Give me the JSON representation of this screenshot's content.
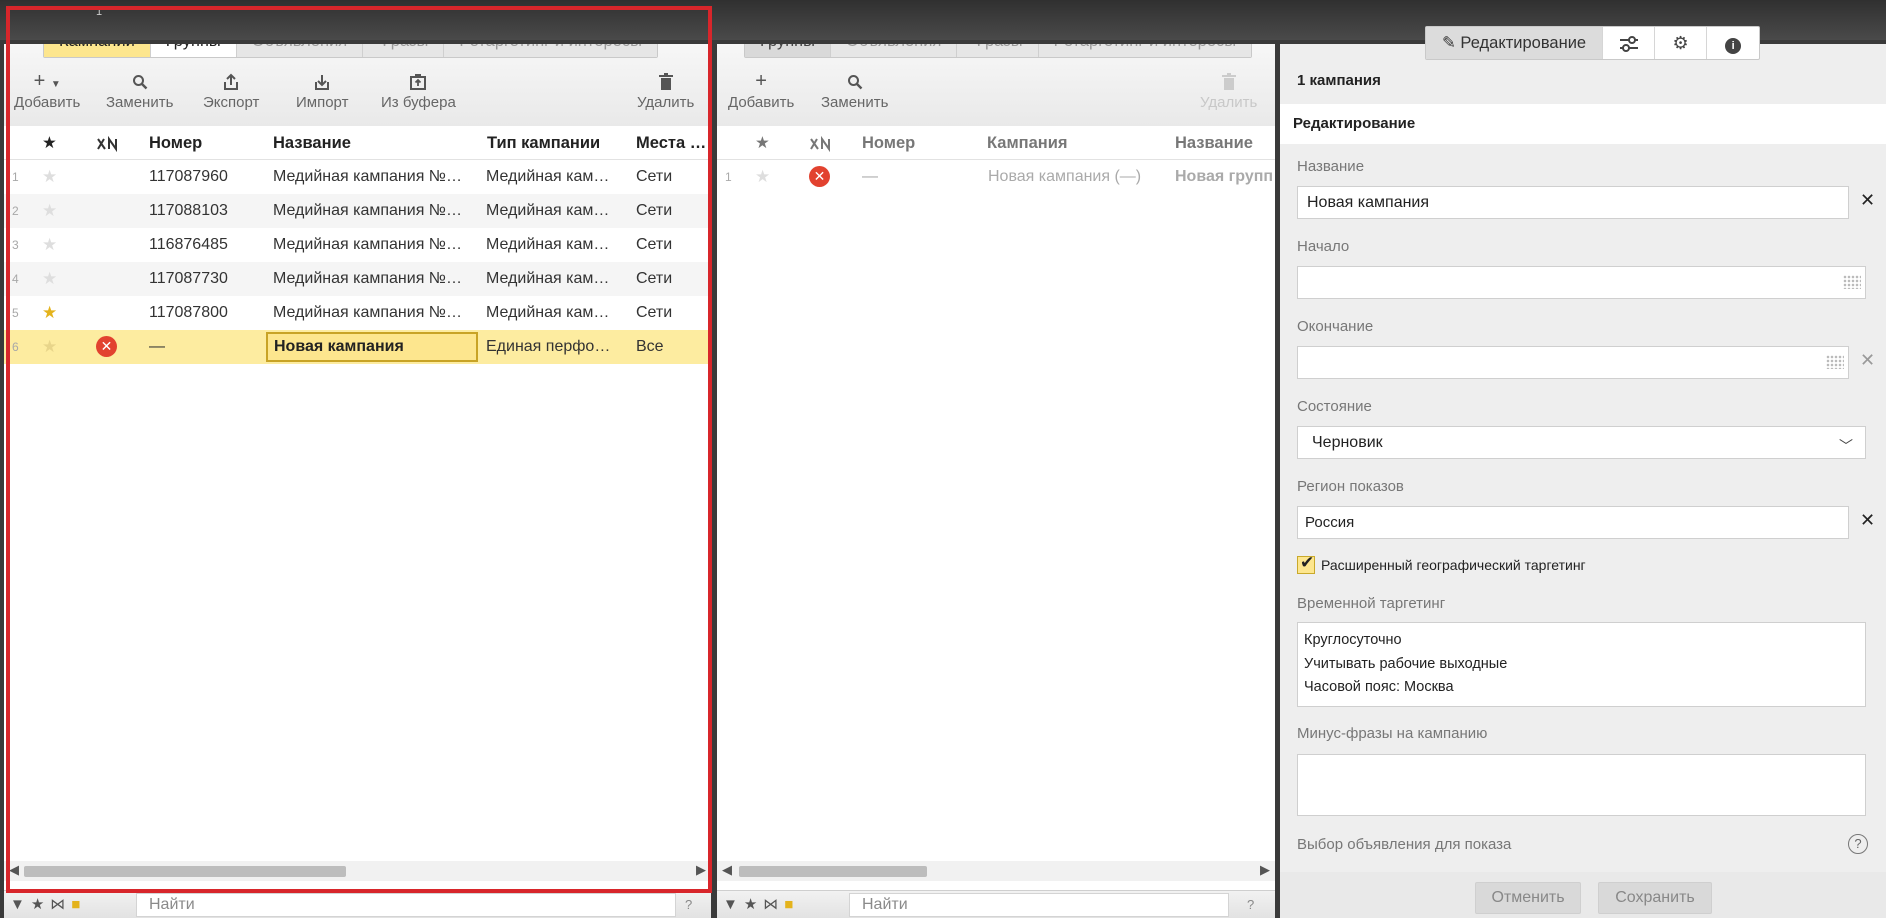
{
  "left": {
    "tab_number": "1",
    "tabs": [
      "Кампании",
      "Группы",
      "Объявления",
      "Фразы",
      "Ретаргетинг и интересы"
    ],
    "toolbar": {
      "add": "Добавить",
      "replace": "Заменить",
      "export": "Экспорт",
      "import": "Импорт",
      "clipboard": "Из буфера",
      "delete": "Удалить"
    },
    "columns": {
      "star": "★",
      "number": "Номер",
      "name": "Название",
      "type": "Тип кампании",
      "places": "Места …"
    },
    "rows": [
      {
        "idx": "1",
        "number": "117087960",
        "name": "Медийная кампания №…",
        "type": "Медийная кам…",
        "places": "Сети"
      },
      {
        "idx": "2",
        "number": "117088103",
        "name": "Медийная кампания №…",
        "type": "Медийная кам…",
        "places": "Сети"
      },
      {
        "idx": "3",
        "number": "116876485",
        "name": "Медийная кампания №…",
        "type": "Медийная кам…",
        "places": "Сети"
      },
      {
        "idx": "4",
        "number": "117087730",
        "name": "Медийная кампания №…",
        "type": "Медийная кам…",
        "places": "Сети"
      },
      {
        "idx": "5",
        "number": "117087800",
        "name": "Медийная кампания №…",
        "type": "Медийная кам…",
        "places": "Сети"
      },
      {
        "idx": "6",
        "number": "—",
        "name": "Новая кампания",
        "type": "Единая перфо…",
        "places": "Все"
      }
    ],
    "search_placeholder": "Найти",
    "help": "?"
  },
  "mid": {
    "tabs": [
      "Группы",
      "Объявления",
      "Фразы",
      "Ретаргетинг и интересы"
    ],
    "toolbar": {
      "add": "Добавить",
      "replace": "Заменить",
      "delete": "Удалить"
    },
    "columns": {
      "star": "★",
      "number": "Номер",
      "campaign": "Кампания",
      "name": "Название"
    },
    "rows": [
      {
        "idx": "1",
        "number": "—",
        "campaign": "Новая кампания (—)",
        "name": "Новая групп"
      }
    ],
    "search_placeholder": "Найти",
    "help": "?"
  },
  "right": {
    "tab_edit": "Редактирование",
    "title": "1 кампания",
    "section": "Редактирование",
    "name_label": "Название",
    "name_value": "Новая кампания",
    "start_label": "Начало",
    "end_label": "Окончание",
    "state_label": "Состояние",
    "state_value": "Черновик",
    "region_label": "Регион показов",
    "region_value": "Россия",
    "geo_checkbox": "Расширенный географический таргетинг",
    "time_label": "Временной таргетинг",
    "time_lines": [
      "Круглосуточно",
      "Учитывать рабочие выходные",
      "Часовой пояс: Москва"
    ],
    "minus_label": "Минус-фразы на кампанию",
    "ad_choice_label": "Выбор объявления для показа",
    "cancel": "Отменить",
    "save": "Сохранить",
    "close_glyph": "✕",
    "help": "?"
  },
  "colors": {
    "accent_yellow": "#fde68e",
    "frame_red": "#d8262b",
    "error_red": "#e2422f",
    "star_gold": "#e4b31c"
  }
}
